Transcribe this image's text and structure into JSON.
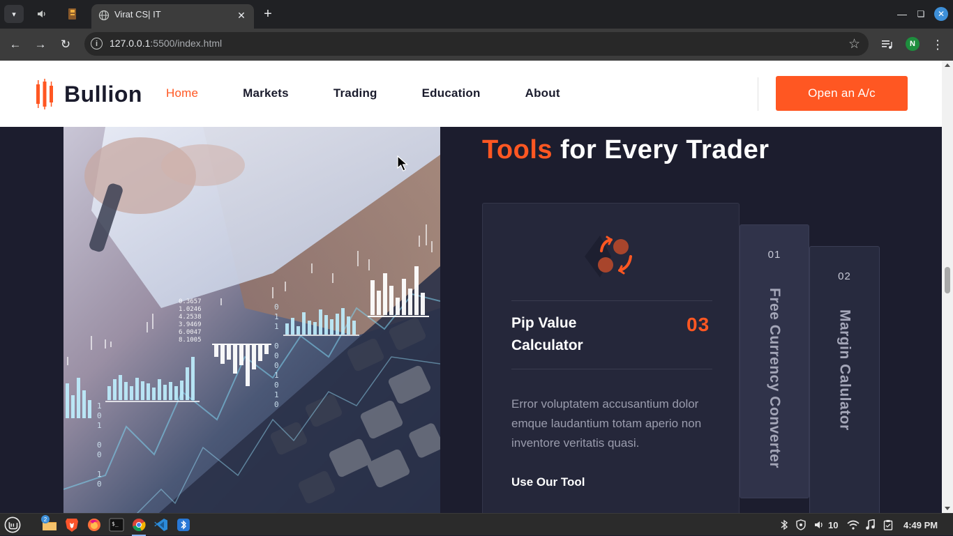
{
  "browser": {
    "tab_title": "Virat CS| IT",
    "url_host": "127.0.0.1",
    "url_path": ":5500/index.html",
    "avatar_letter": "N"
  },
  "site": {
    "logo_text": "Bullion",
    "nav": [
      {
        "label": "Home",
        "active": true
      },
      {
        "label": "Markets"
      },
      {
        "label": "Trading"
      },
      {
        "label": "Education"
      },
      {
        "label": "About"
      }
    ],
    "cta_label": "Open an A/c",
    "brand_color": "#ff5722"
  },
  "section": {
    "title_accent": "Tools",
    "title_rest": " for Every Trader"
  },
  "tools": {
    "active": {
      "number": "03",
      "title": "Pip Value Calculator",
      "description": "Error voluptatem accusantium dolor emque laudantium totam aperio non inventore veritatis quasi.",
      "link_label": "Use Our Tool"
    },
    "side": [
      {
        "number": "01",
        "label": "Free Currency Converter"
      },
      {
        "number": "02",
        "label": "Margin Calulator"
      }
    ]
  },
  "hero_overlay": {
    "ticker_values": [
      "0.3657",
      "1.0246",
      "4.2538",
      "3.9469",
      "6.0047",
      "8.1005"
    ],
    "binary_col1": [
      "0",
      "1",
      "1",
      "0",
      "0",
      "0",
      "1",
      "0",
      "1",
      "0"
    ],
    "binary_col2": [
      "1",
      "0",
      "1",
      "0",
      "0",
      "1",
      "0"
    ]
  },
  "taskbar": {
    "notification_count": "2",
    "volume_level": "10",
    "clock": "4:49 PM"
  }
}
